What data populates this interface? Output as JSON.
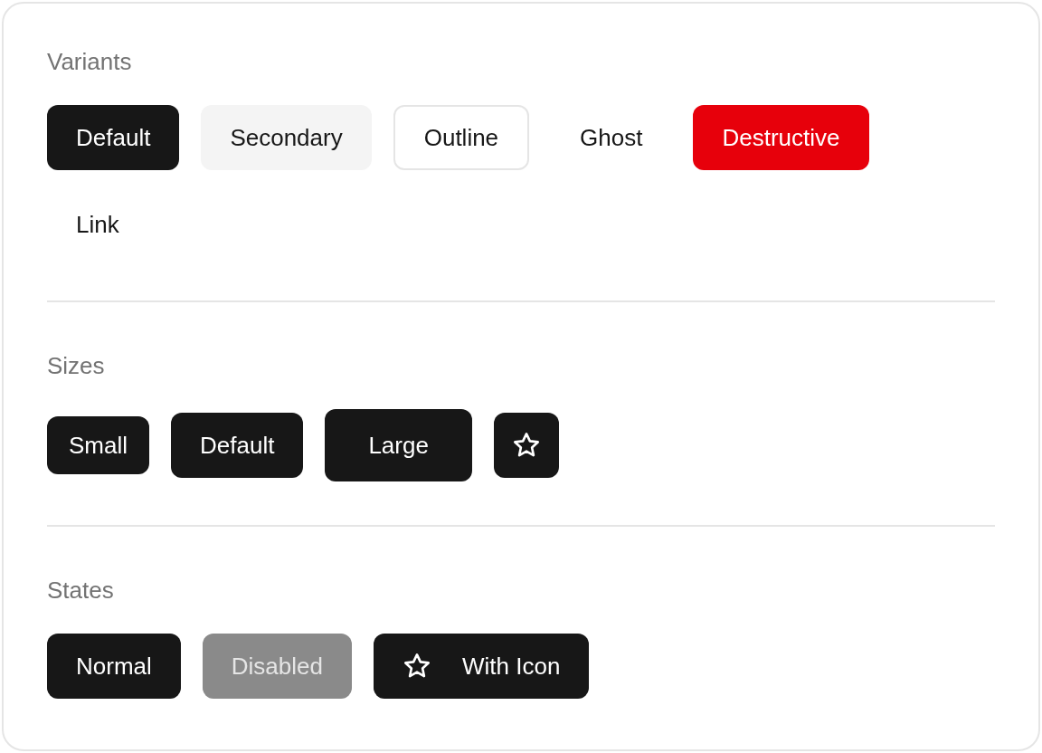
{
  "sections": [
    {
      "title": "Variants",
      "buttons": [
        {
          "label": "Default",
          "kind": "default"
        },
        {
          "label": "Secondary",
          "kind": "secondary"
        },
        {
          "label": "Outline",
          "kind": "outline"
        },
        {
          "label": "Ghost",
          "kind": "ghost"
        },
        {
          "label": "Destructive",
          "kind": "destructive"
        },
        {
          "label": "Link",
          "kind": "link"
        }
      ]
    },
    {
      "title": "Sizes",
      "buttons": [
        {
          "label": "Small",
          "kind": "small"
        },
        {
          "label": "Default",
          "kind": "medium"
        },
        {
          "label": "Large",
          "kind": "large"
        },
        {
          "kind": "icon"
        }
      ]
    },
    {
      "title": "States",
      "buttons": [
        {
          "label": "Normal",
          "disabled": false,
          "icon": false
        },
        {
          "label": "Disabled",
          "disabled": true,
          "icon": false
        },
        {
          "label": "With Icon",
          "disabled": false,
          "icon": true
        }
      ]
    }
  ]
}
